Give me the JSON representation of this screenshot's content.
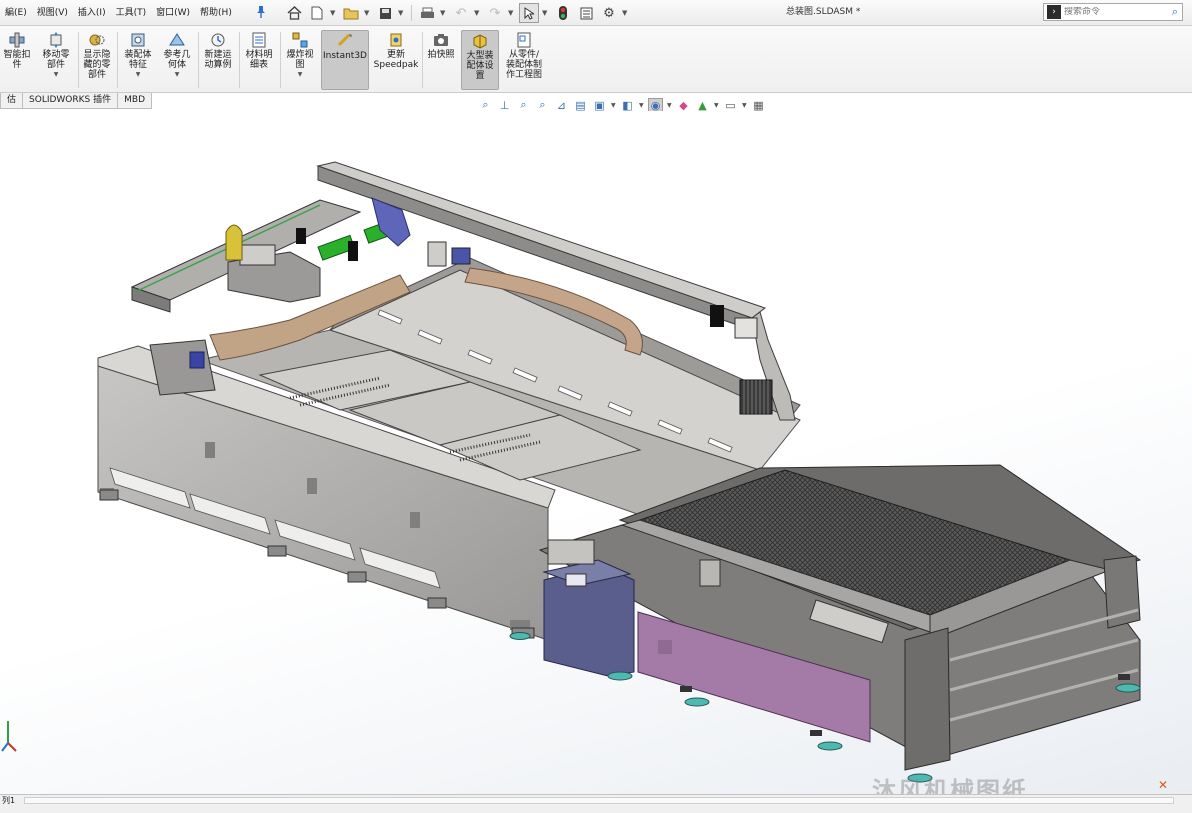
{
  "menu": {
    "items": [
      "編(E)",
      "视图(V)",
      "插入(I)",
      "工具(T)",
      "窗口(W)",
      "帮助(H)"
    ]
  },
  "document_title": "总装图.SLDASM *",
  "search": {
    "placeholder": "搜索命令"
  },
  "ribbon": {
    "buttons": [
      {
        "label": "智能扣\n件",
        "icon": "smart-fasteners-icon"
      },
      {
        "label": "移动零\n部件",
        "icon": "move-component-icon"
      },
      {
        "label": "显示隐\n藏的零\n部件",
        "icon": "show-hidden-components-icon"
      },
      {
        "label": "装配体\n特征",
        "icon": "assembly-features-icon"
      },
      {
        "label": "参考几\n何体",
        "icon": "reference-geometry-icon"
      },
      {
        "label": "新建运\n动算例",
        "icon": "new-motion-study-icon"
      },
      {
        "label": "材料明\n细表",
        "icon": "bill-of-materials-icon"
      },
      {
        "label": "爆炸视\n图",
        "icon": "exploded-view-icon"
      },
      {
        "label": "Instant3D",
        "icon": "instant3d-icon"
      },
      {
        "label": "更新\nSpeedpak",
        "icon": "update-speedpak-icon"
      },
      {
        "label": "拍快照",
        "icon": "snapshot-icon"
      },
      {
        "label": "大型装\n配体设\n置",
        "icon": "large-assembly-settings-icon"
      },
      {
        "label": "从零件/\n装配体制\n作工程图",
        "icon": "make-drawing-icon"
      }
    ]
  },
  "tabs": [
    "估",
    "SOLIDWORKS 插件",
    "MBD"
  ],
  "status": {
    "sheet_tab": "列1"
  },
  "watermark": "沐风机械图纸",
  "colors": {
    "ribbon_bg": "#f0f0f0",
    "active_button": "#c9c9c9",
    "frame_gray": "#8c8c8c",
    "cabinet_blue": "#5a5f8c",
    "purple_panel": "#a47aa6",
    "green_module": "#2bb02b",
    "tan_chain": "#b8977a"
  }
}
